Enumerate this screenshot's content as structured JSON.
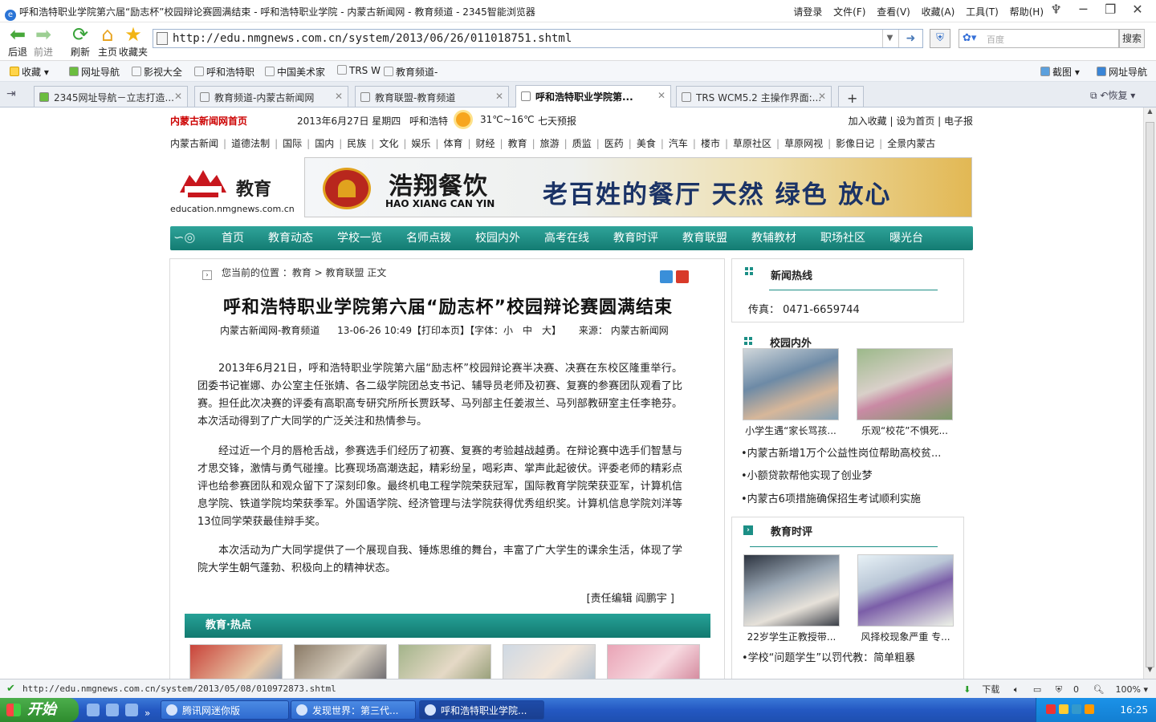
{
  "browser": {
    "window_title": "呼和浩特职业学院第六届“励志杯”校园辩论赛圆满结束 - 呼和浩特职业学院 - 内蒙古新闻网 - 教育频道 - 2345智能浏览器",
    "login": "请登录",
    "menus": [
      "文件(F)",
      "查看(V)",
      "收藏(A)",
      "工具(T)",
      "帮助(H)"
    ],
    "nav": {
      "back": "后退",
      "forward": "前进",
      "refresh": "刷新",
      "home": "主页",
      "favorites": "收藏夹"
    },
    "url": "http://edu.nmgnews.com.cn/system/2013/06/26/011018751.shtml",
    "search_placeholder": "百度",
    "search_button": "搜索",
    "favorites_bar": [
      "收藏",
      "网址导航",
      "影视大全",
      "呼和浩特职",
      "中国美术家",
      "TRS W",
      "教育频道-"
    ],
    "favbar_right": [
      "截图",
      "网址导航"
    ],
    "tabs": [
      {
        "label": "2345网址导航－立志打造..."
      },
      {
        "label": "教育频道-内蒙古新闻网"
      },
      {
        "label": "教育联盟-教育频道"
      },
      {
        "label": "呼和浩特职业学院第..."
      },
      {
        "label": "TRS WCM5.2 主操作界面:..."
      }
    ],
    "restore_label": "恢复",
    "status_url": "http://edu.nmgnews.com.cn/system/2013/05/08/010972873.shtml",
    "status_right": {
      "download": "下载",
      "count": "0",
      "zoom": "100%"
    }
  },
  "page": {
    "topinfo": {
      "home_link": "内蒙古新闻网首页",
      "date": "2013年6月27日 星期四",
      "city": "呼和浩特",
      "temp": "31℃~16℃",
      "forecast": "七天预报",
      "links": "加入收藏 | 设为首页 | 电子报"
    },
    "channels": [
      "内蒙古新闻",
      "道德法制",
      "国际",
      "国内",
      "民族",
      "文化",
      "娱乐",
      "体育",
      "财经",
      "教育",
      "旅游",
      "质监",
      "医药",
      "美食",
      "汽车",
      "楼市",
      "草原社区",
      "草原网视",
      "影像日记",
      "全景内蒙古"
    ],
    "logo_text": "教育",
    "logo_domain": "education.nmgnews.com.cn",
    "banner": {
      "brand": "浩翔餐饮",
      "pinyin": "HAO XIANG CAN YIN",
      "slogan": "老百姓的餐厅  天然  绿色  放心"
    },
    "mainnav": [
      "首页",
      "教育动态",
      "学校一览",
      "名师点拨",
      "校园内外",
      "高考在线",
      "教育时评",
      "教育联盟",
      "教辅教材",
      "职场社区",
      "曝光台"
    ],
    "breadcrumb": "您当前的位置 ：教育 > 教育联盟 正文",
    "article": {
      "title": "呼和浩特职业学院第六届“励志杯”校园辩论赛圆满结束",
      "meta_source": "内蒙古新闻网-教育频道",
      "meta_time": "13-06-26 10:49【打印本页】【字体：小　中　大】",
      "meta_origin": "来源： 内蒙古新闻网",
      "paragraphs": [
        "2013年6月21日，呼和浩特职业学院第六届“励志杯”校园辩论赛半决赛、决赛在东校区隆重举行。团委书记崔娜、办公室主任张婧、各二级学院团总支书记、辅导员老师及初赛、复赛的参赛团队观看了比赛。担任此次决赛的评委有高职高专研究所所长贾跃琴、马列部主任姜淑兰、马列部教研室主任李艳芬。本次活动得到了广大同学的广泛关注和热情参与。",
        "经过近一个月的唇枪舌战，参赛选手们经历了初赛、复赛的考验越战越勇。在辩论赛中选手们智慧与才思交锋，激情与勇气碰撞。比赛现场高潮迭起，精彩纷呈，喝彩声、掌声此起彼伏。评委老师的精彩点评也给参赛团队和观众留下了深刻印象。最终机电工程学院荣获冠军，国际教育学院荣获亚军，计算机信息学院、铁道学院均荣获季军。外国语学院、经济管理与法学院获得优秀组织奖。计算机信息学院刘洋等13位同学荣获最佳辩手奖。",
        "本次活动为广大同学提供了一个展现自我、锤炼思维的舞台，丰富了广大学生的课余生活，体现了学院大学生朝气蓬勃、积极向上的精神状态。"
      ],
      "editor": "[责任编辑  阎鹏宇  ]"
    },
    "hot_title": "教育·热点",
    "right": {
      "news_hotline": {
        "title": "新闻热线",
        "fax": "传真： 0471-6659744"
      },
      "campus": {
        "title": "校园内外",
        "captions": [
          "小学生遇“家长骂孩...",
          "乐观“校花”不惧死..."
        ],
        "items": [
          "•内蒙古新增1万个公益性岗位帮助高校贫...",
          "•小额贷款帮他实现了创业梦",
          "•内蒙古6项措施确保招生考试顺利实施"
        ]
      },
      "commentary": {
        "title": "教育时评",
        "captions": [
          "22岁学生正教授带...",
          "风择校现象严重 专..."
        ],
        "items": [
          "•学校“问题学生”以罚代教：简单粗暴"
        ]
      }
    }
  },
  "taskbar": {
    "start": "开始",
    "buttons": [
      "腾讯网迷你版",
      "发现世界：第三代...",
      "呼和浩特职业学院..."
    ],
    "clock": "16:25"
  }
}
